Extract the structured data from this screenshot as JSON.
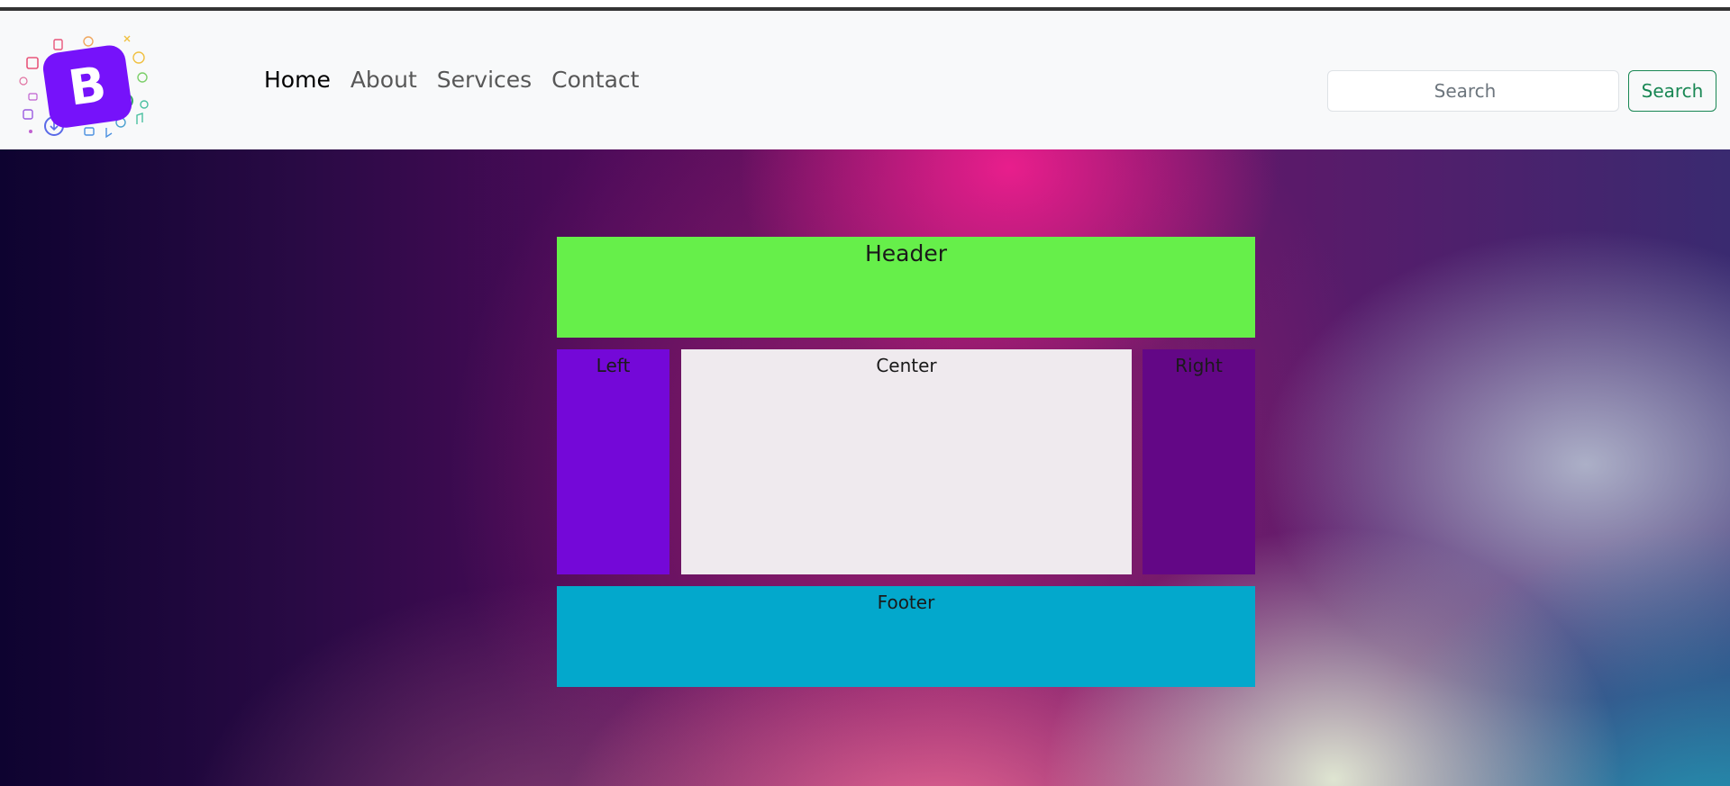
{
  "navbar": {
    "brand": {
      "logo_letter": "B",
      "logo_icon": "bootstrap-logo-icon"
    },
    "links": [
      {
        "label": "Home",
        "active": true
      },
      {
        "label": "About",
        "active": false
      },
      {
        "label": "Services",
        "active": false
      },
      {
        "label": "Contact",
        "active": false
      }
    ],
    "search": {
      "placeholder": "Search",
      "button_label": "Search"
    }
  },
  "layout": {
    "header_label": "Header",
    "left_label": "Left",
    "center_label": "Center",
    "right_label": "Right",
    "footer_label": "Footer"
  },
  "colors": {
    "header": "#66ef4a",
    "left": "#7408d8",
    "center": "#efeaee",
    "right": "#630786",
    "footer": "#03a8cc",
    "search_button": "#198754",
    "logo": "#7612fa"
  }
}
